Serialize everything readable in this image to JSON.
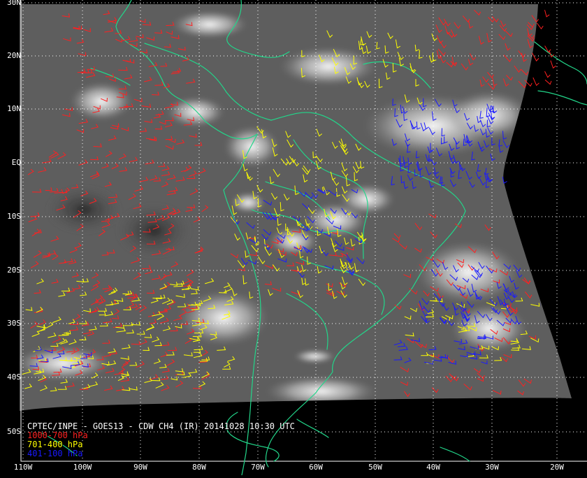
{
  "map": {
    "caption": "CPTEC/INPE - GOES13 - CDW CH4 (IR) 20141028 10:30 UTC",
    "latitude_labels": [
      "30N",
      "20N",
      "10N",
      "EQ",
      "10S",
      "20S",
      "30S",
      "40S",
      "50S"
    ],
    "longitude_labels": [
      "110W",
      "100W",
      "90W",
      "80W",
      "70W",
      "60W",
      "50W",
      "40W",
      "30W",
      "20W"
    ],
    "legend": [
      {
        "label": "1000-700 hPa",
        "color": "#ff2020"
      },
      {
        "label": "701-400 hPa",
        "color": "#ffff00"
      },
      {
        "label": "401-100 hPa",
        "color": "#1a1aff"
      }
    ],
    "colors": {
      "coastline": "#22d68a",
      "grid": "#ffffff",
      "text": "#ffffff",
      "background": "#000000"
    }
  }
}
